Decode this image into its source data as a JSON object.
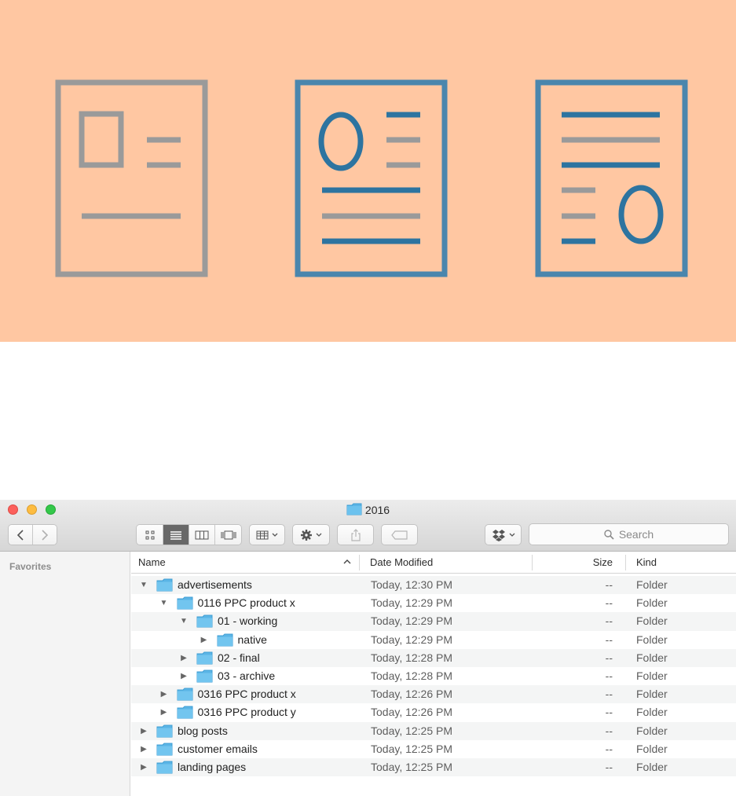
{
  "window": {
    "title": "2016",
    "colors": {
      "folder_blue": "#5bb5e6",
      "hero_bg": "#ffc7a2",
      "icon_gray": "#9a9a9a",
      "icon_blue": "#3f7fa7"
    }
  },
  "hero_icons": [
    "document-image-icon",
    "document-profile-icon",
    "document-text-icon"
  ],
  "toolbar": {
    "back_icon": "chevron-left-icon",
    "forward_icon": "chevron-right-icon",
    "view_modes": [
      "icon-view",
      "list-view",
      "column-view",
      "cover-flow-view"
    ],
    "active_view": "list-view",
    "search_placeholder": "Search"
  },
  "sidebar": {
    "heading": "Favorites"
  },
  "columns": {
    "name": "Name",
    "date": "Date Modified",
    "size": "Size",
    "kind": "Kind"
  },
  "rows": [
    {
      "name": "advertisements",
      "date": "Today, 12:30 PM",
      "size": "--",
      "kind": "Folder",
      "depth": 0,
      "expanded": true
    },
    {
      "name": "0116 PPC product x",
      "date": "Today, 12:29 PM",
      "size": "--",
      "kind": "Folder",
      "depth": 1,
      "expanded": true
    },
    {
      "name": "01 - working",
      "date": "Today, 12:29 PM",
      "size": "--",
      "kind": "Folder",
      "depth": 2,
      "expanded": true
    },
    {
      "name": "native",
      "date": "Today, 12:29 PM",
      "size": "--",
      "kind": "Folder",
      "depth": 3,
      "expanded": false
    },
    {
      "name": "02 - final",
      "date": "Today, 12:28 PM",
      "size": "--",
      "kind": "Folder",
      "depth": 2,
      "expanded": false
    },
    {
      "name": "03 - archive",
      "date": "Today, 12:28 PM",
      "size": "--",
      "kind": "Folder",
      "depth": 2,
      "expanded": false
    },
    {
      "name": "0316 PPC product x",
      "date": "Today, 12:26 PM",
      "size": "--",
      "kind": "Folder",
      "depth": 1,
      "expanded": false
    },
    {
      "name": "0316 PPC product y",
      "date": "Today, 12:26 PM",
      "size": "--",
      "kind": "Folder",
      "depth": 1,
      "expanded": false
    },
    {
      "name": "blog posts",
      "date": "Today, 12:25 PM",
      "size": "--",
      "kind": "Folder",
      "depth": 0,
      "expanded": false
    },
    {
      "name": "customer emails",
      "date": "Today, 12:25 PM",
      "size": "--",
      "kind": "Folder",
      "depth": 0,
      "expanded": false
    },
    {
      "name": "landing pages",
      "date": "Today, 12:25 PM",
      "size": "--",
      "kind": "Folder",
      "depth": 0,
      "expanded": false
    }
  ]
}
